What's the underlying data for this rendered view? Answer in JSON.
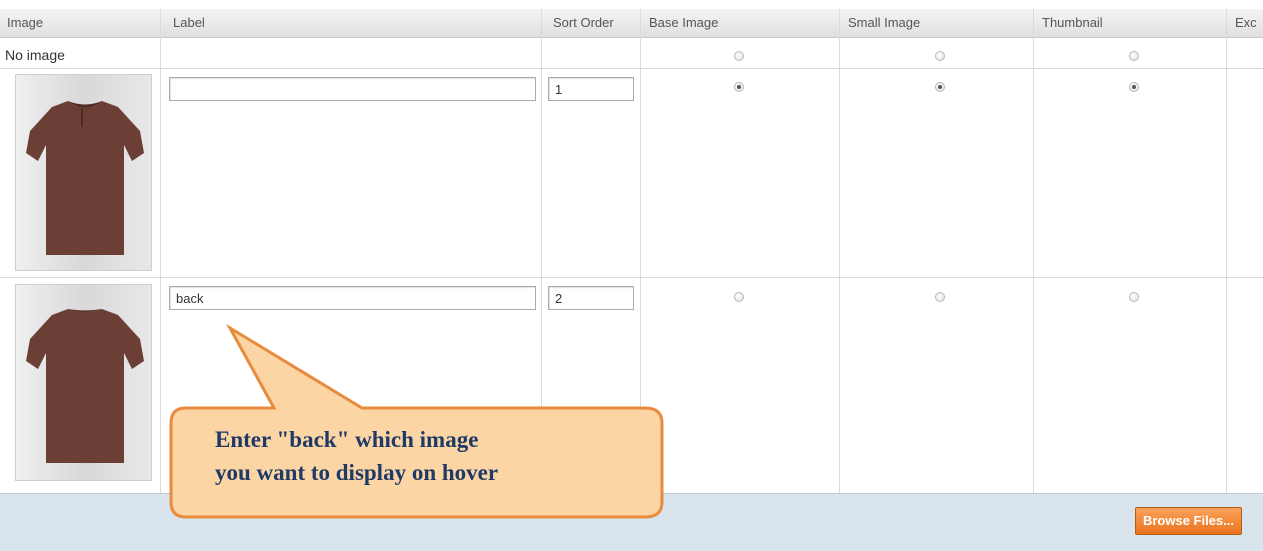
{
  "table": {
    "headers": {
      "image": "Image",
      "label": "Label",
      "sort_order": "Sort Order",
      "base_image": "Base Image",
      "small_image": "Small Image",
      "thumbnail": "Thumbnail",
      "exclude": "Exc"
    },
    "no_image_row": {
      "text": "No image"
    },
    "rows": [
      {
        "label_value": "",
        "sort_order": "1",
        "base_checked": true,
        "small_checked": true,
        "thumb_checked": true
      },
      {
        "label_value": "back",
        "sort_order": "2",
        "base_checked": false,
        "small_checked": false,
        "thumb_checked": false
      }
    ]
  },
  "callout": {
    "line1": "Enter \"back\" which image",
    "line2": "you want to display on hover"
  },
  "footer": {
    "browse_button": "Browse Files..."
  },
  "colors": {
    "shirt": "#6b3f36",
    "callout_fill": "#fcd5a5",
    "callout_border": "#e88b3c",
    "callout_text": "#1f3a66",
    "button": "#f0822e"
  }
}
